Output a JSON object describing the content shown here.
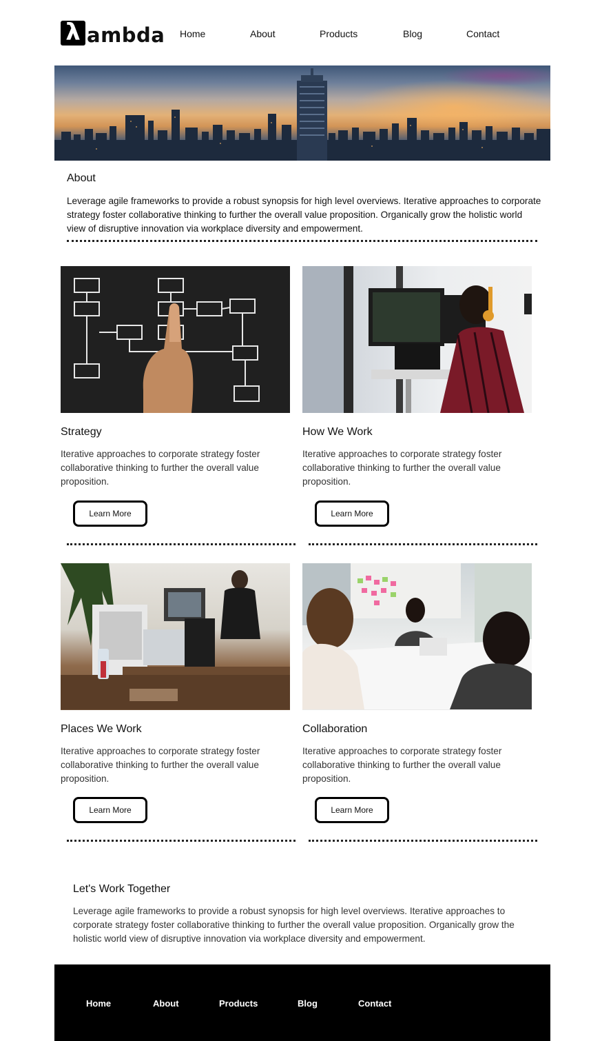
{
  "brand": {
    "logo_symbol": "λ",
    "logo_text": "ambda"
  },
  "nav": [
    "Home",
    "About",
    "Products",
    "Blog",
    "Contact"
  ],
  "about": {
    "title": "About",
    "text": "Leverage agile frameworks to provide a robust synopsis for high level overviews. Iterative approaches to corporate strategy foster collaborative thinking to further the overall value proposition. Organically grow the holistic world view of disruptive innovation via workplace diversity and empowerment."
  },
  "cards": [
    {
      "title": "Strategy",
      "text": "Iterative approaches to corporate strategy foster collaborative thinking to further the overall value proposition.",
      "button": "Learn More"
    },
    {
      "title": "How We Work",
      "text": "Iterative approaches to corporate strategy foster collaborative thinking to further the overall value proposition.",
      "button": "Learn More"
    },
    {
      "title": "Places We Work",
      "text": "Iterative approaches to corporate strategy foster collaborative thinking to further the overall value proposition.",
      "button": "Learn More"
    },
    {
      "title": "Collaboration",
      "text": "Iterative approaches to corporate strategy foster collaborative thinking to further the overall value proposition.",
      "button": "Learn More"
    }
  ],
  "together": {
    "title": "Let's Work Together",
    "text": "Leverage agile frameworks to provide a robust synopsis for high level overviews. Iterative approaches to corporate strategy foster collaborative thinking to further the overall value proposition. Organically grow the holistic world view of disruptive innovation via workplace diversity and empowerment."
  },
  "footer_nav": [
    "Home",
    "About",
    "Products",
    "Blog",
    "Contact"
  ],
  "colors": {
    "footer_bg": "#000000",
    "text": "#111111",
    "button_border": "#000000"
  }
}
